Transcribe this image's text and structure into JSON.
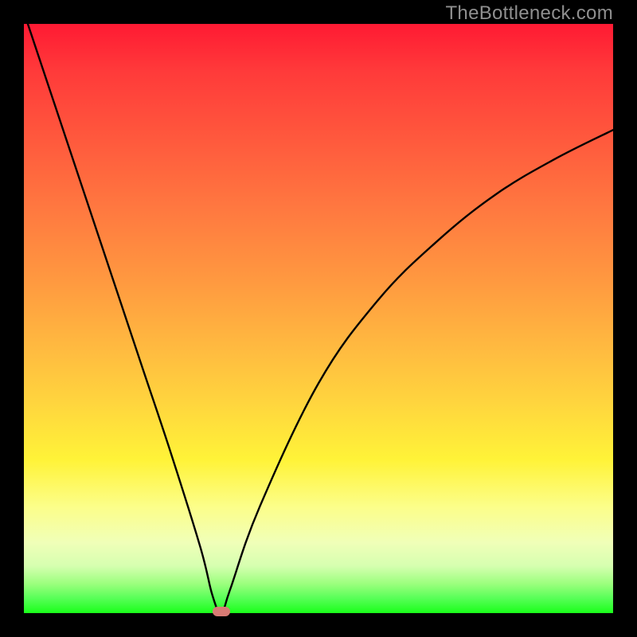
{
  "watermark": "TheBottleneck.com",
  "colors": {
    "background": "#000000",
    "curve": "#000000",
    "marker": "#d87a74"
  },
  "chart_data": {
    "type": "line",
    "title": "",
    "xlabel": "",
    "ylabel": "",
    "xlim": [
      0,
      100
    ],
    "ylim": [
      0,
      100
    ],
    "series": [
      {
        "name": "bottleneck-curve",
        "x": [
          0,
          5,
          10,
          15,
          20,
          25,
          30,
          32,
          33.5,
          35,
          40,
          50,
          60,
          70,
          80,
          90,
          100
        ],
        "y": [
          102,
          87,
          72,
          57,
          42,
          27,
          11,
          3,
          0,
          4,
          18,
          39,
          53,
          63,
          71,
          77,
          82
        ]
      }
    ],
    "annotations": [
      {
        "name": "optimal-point",
        "x": 33.5,
        "y": 0
      }
    ],
    "gradient_stops": [
      {
        "pos": 0,
        "color": "#ff1a33"
      },
      {
        "pos": 50,
        "color": "#ffb740"
      },
      {
        "pos": 75,
        "color": "#fff338"
      },
      {
        "pos": 100,
        "color": "#1aff1a"
      }
    ]
  }
}
